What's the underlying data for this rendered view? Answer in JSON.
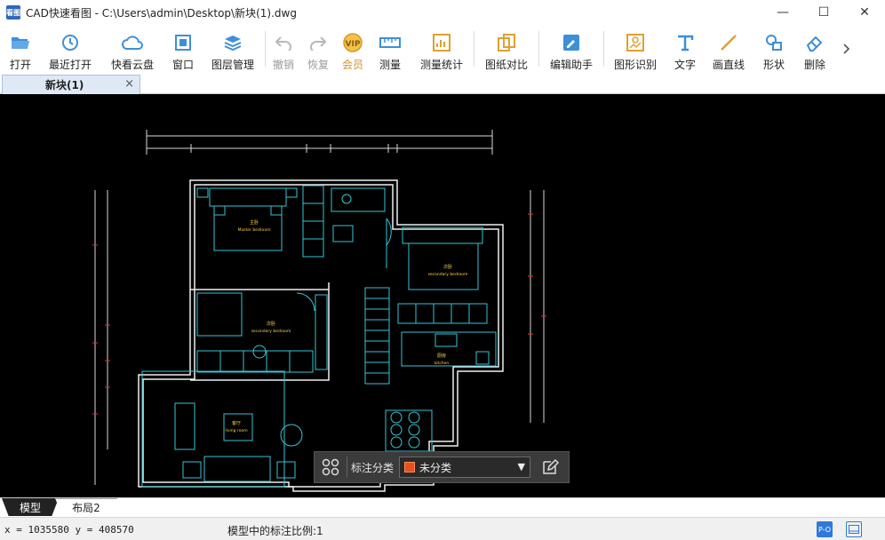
{
  "window": {
    "app_icon_text": "看图",
    "title": "CAD快速看图 - C:\\Users\\admin\\Desktop\\新块(1).dwg",
    "minimize_symbol": "—",
    "maximize_symbol": "☐",
    "close_symbol": "✕"
  },
  "toolbar": {
    "open": "打开",
    "recent": "最近打开",
    "cloud": "快看云盘",
    "window": "窗口",
    "layers": "图层管理",
    "undo": "撤销",
    "redo": "恢复",
    "vip": "会员",
    "measure": "测量",
    "measure_stats": "测量统计",
    "compare": "图纸对比",
    "edit_helper": "编辑助手",
    "shape_recognize": "图形识别",
    "text": "文字",
    "line": "画直线",
    "shape": "形状",
    "delete": "删除"
  },
  "doc_tab": {
    "label": "新块(1)",
    "close": "×"
  },
  "annotation": {
    "label": "标注分类",
    "selected": "未分类",
    "swatch_color": "#e8501e"
  },
  "layout_tabs": {
    "model": "模型",
    "layout2": "布局2"
  },
  "status": {
    "coords": "x = 1035580  y = 408570",
    "scale": "模型中的标注比例:1",
    "btn1": "P-O"
  },
  "drawing": {
    "rooms": [
      {
        "cn": "主卧",
        "en": "Master bedroom"
      },
      {
        "cn": "次卧",
        "en": "secondary bedroom"
      },
      {
        "cn": "次卧",
        "en": "secondary bedroom"
      },
      {
        "cn": "厨房",
        "en": "kitchen"
      },
      {
        "cn": "客厅",
        "en": "living room"
      }
    ]
  }
}
